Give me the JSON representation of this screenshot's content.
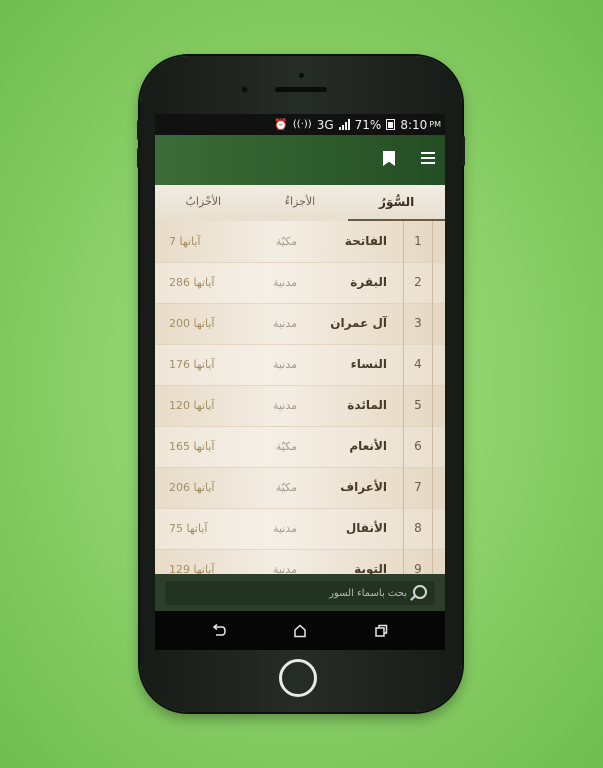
{
  "status": {
    "battery": "71%",
    "network": "3G",
    "time": "8:10",
    "ampm": "PM"
  },
  "tabs": [
    {
      "label": "السُّوَرُ",
      "active": true
    },
    {
      "label": "الأجزاءُ",
      "active": false
    },
    {
      "label": "الأحْزابُ",
      "active": false
    }
  ],
  "surahs": [
    {
      "num": "1",
      "name": "الفاتحة",
      "type": "مكيّة",
      "ayat": "آياتها 7"
    },
    {
      "num": "2",
      "name": "البقرة",
      "type": "مدنية",
      "ayat": "آياتها 286"
    },
    {
      "num": "3",
      "name": "آل عمران",
      "type": "مدنية",
      "ayat": "آياتها 200"
    },
    {
      "num": "4",
      "name": "النساء",
      "type": "مدنية",
      "ayat": "آياتها 176"
    },
    {
      "num": "5",
      "name": "المائدة",
      "type": "مدنية",
      "ayat": "آياتها 120"
    },
    {
      "num": "6",
      "name": "الأنعام",
      "type": "مكيّة",
      "ayat": "آياتها 165"
    },
    {
      "num": "7",
      "name": "الأعراف",
      "type": "مكيّة",
      "ayat": "آياتها 206"
    },
    {
      "num": "8",
      "name": "الأنفال",
      "type": "مدنية",
      "ayat": "آياتها 75"
    },
    {
      "num": "9",
      "name": "التوبة",
      "type": "مدنية",
      "ayat": "آياتها 129"
    }
  ],
  "search": {
    "placeholder": "بحث بأسماء السور"
  },
  "icons": {
    "menu": "menu-icon",
    "bookmark": "bookmark-icon",
    "search": "search-icon",
    "back": "back-icon",
    "home": "home-icon",
    "recents": "recents-icon"
  },
  "colors": {
    "background": "#8fd26c",
    "appbar": "#2d5a2b",
    "list_bg": "#efe6d8",
    "search_bg": "#2c3f2a"
  }
}
